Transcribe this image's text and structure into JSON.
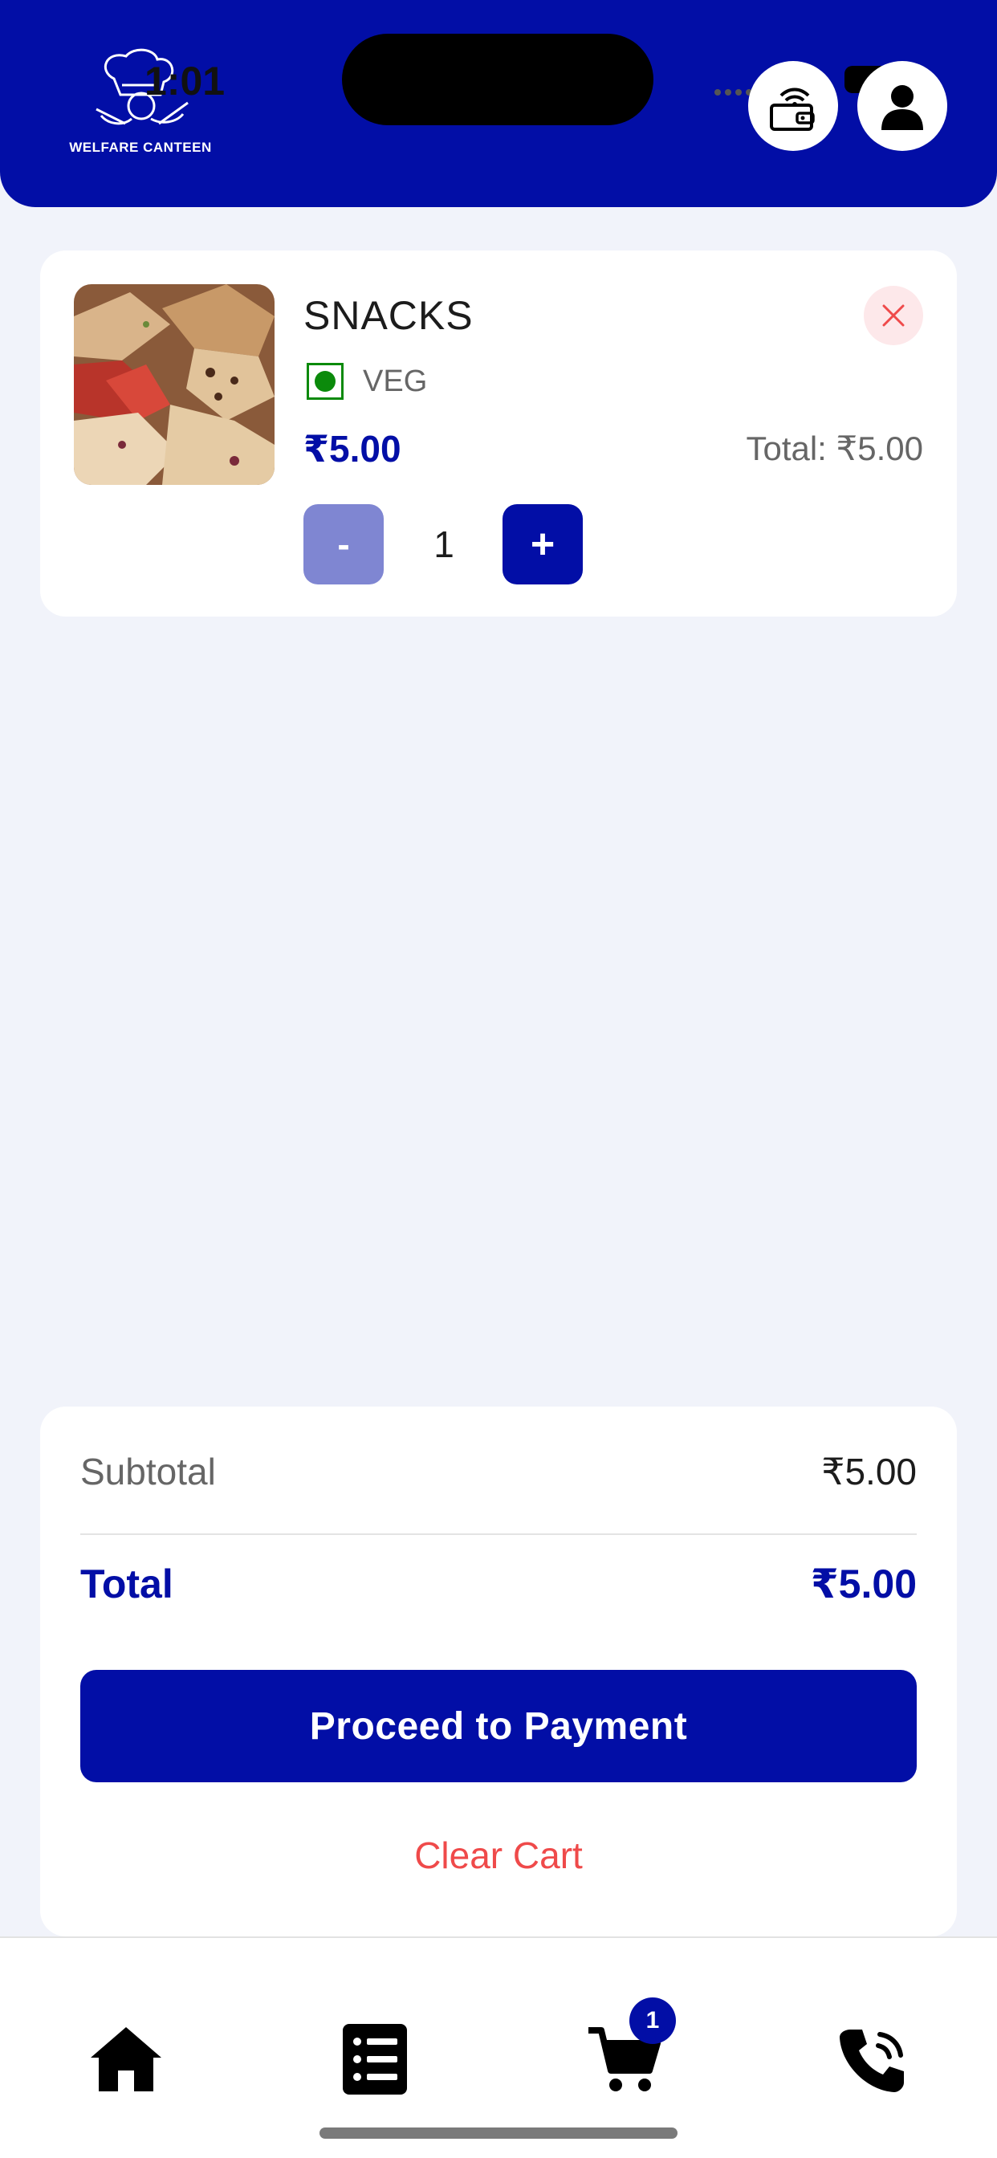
{
  "status_bar": {
    "time": "1:01"
  },
  "header": {
    "brand": "WELFARE CANTEEN",
    "icons": [
      "chef-logo",
      "wallet-icon",
      "profile-icon"
    ]
  },
  "cart_item": {
    "name": "SNACKS",
    "diet": "VEG",
    "price": "₹5.00",
    "total": "Total: ₹5.00",
    "quantity": "1",
    "minus_label": "-",
    "plus_label": "+",
    "image": "pastries and baked snacks photo"
  },
  "summary": {
    "subtotal_label": "Subtotal",
    "subtotal_value": "₹5.00",
    "total_label": "Total",
    "total_value": "₹5.00",
    "pay_button": "Proceed to Payment",
    "clear_button": "Clear Cart"
  },
  "bottom_nav": {
    "items": [
      "home-icon",
      "orders-list-icon",
      "cart-icon",
      "phone-call-icon"
    ],
    "cart_badge": "1"
  },
  "colors": {
    "brand": "#020ea6",
    "background": "#f1f3fa",
    "danger": "#ef4a4a",
    "veg": "#0b8a0b"
  }
}
